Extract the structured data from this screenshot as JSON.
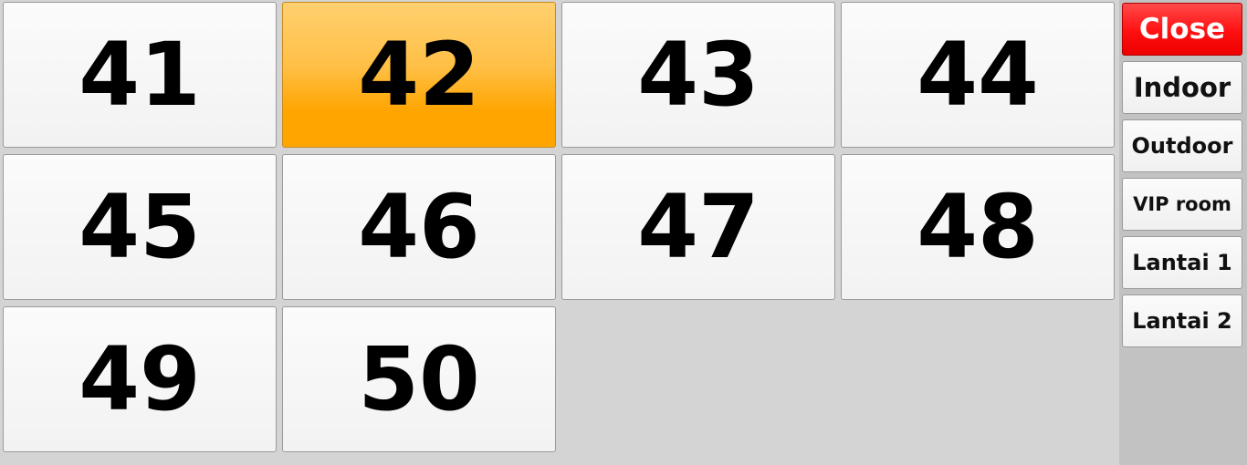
{
  "tables": [
    {
      "label": "41",
      "selected": false
    },
    {
      "label": "42",
      "selected": true
    },
    {
      "label": "43",
      "selected": false
    },
    {
      "label": "44",
      "selected": false
    },
    {
      "label": "45",
      "selected": false
    },
    {
      "label": "46",
      "selected": false
    },
    {
      "label": "47",
      "selected": false
    },
    {
      "label": "48",
      "selected": false
    },
    {
      "label": "49",
      "selected": false
    },
    {
      "label": "50",
      "selected": false
    }
  ],
  "sidebar": {
    "close_label": "Close",
    "areas": [
      "Indoor",
      "Outdoor",
      "VIP room",
      "Lantai 1",
      "Lantai 2"
    ]
  },
  "colors": {
    "selected_table": "#ffa500",
    "close_button": "#ff1a1a",
    "background": "#d4d4d4"
  }
}
